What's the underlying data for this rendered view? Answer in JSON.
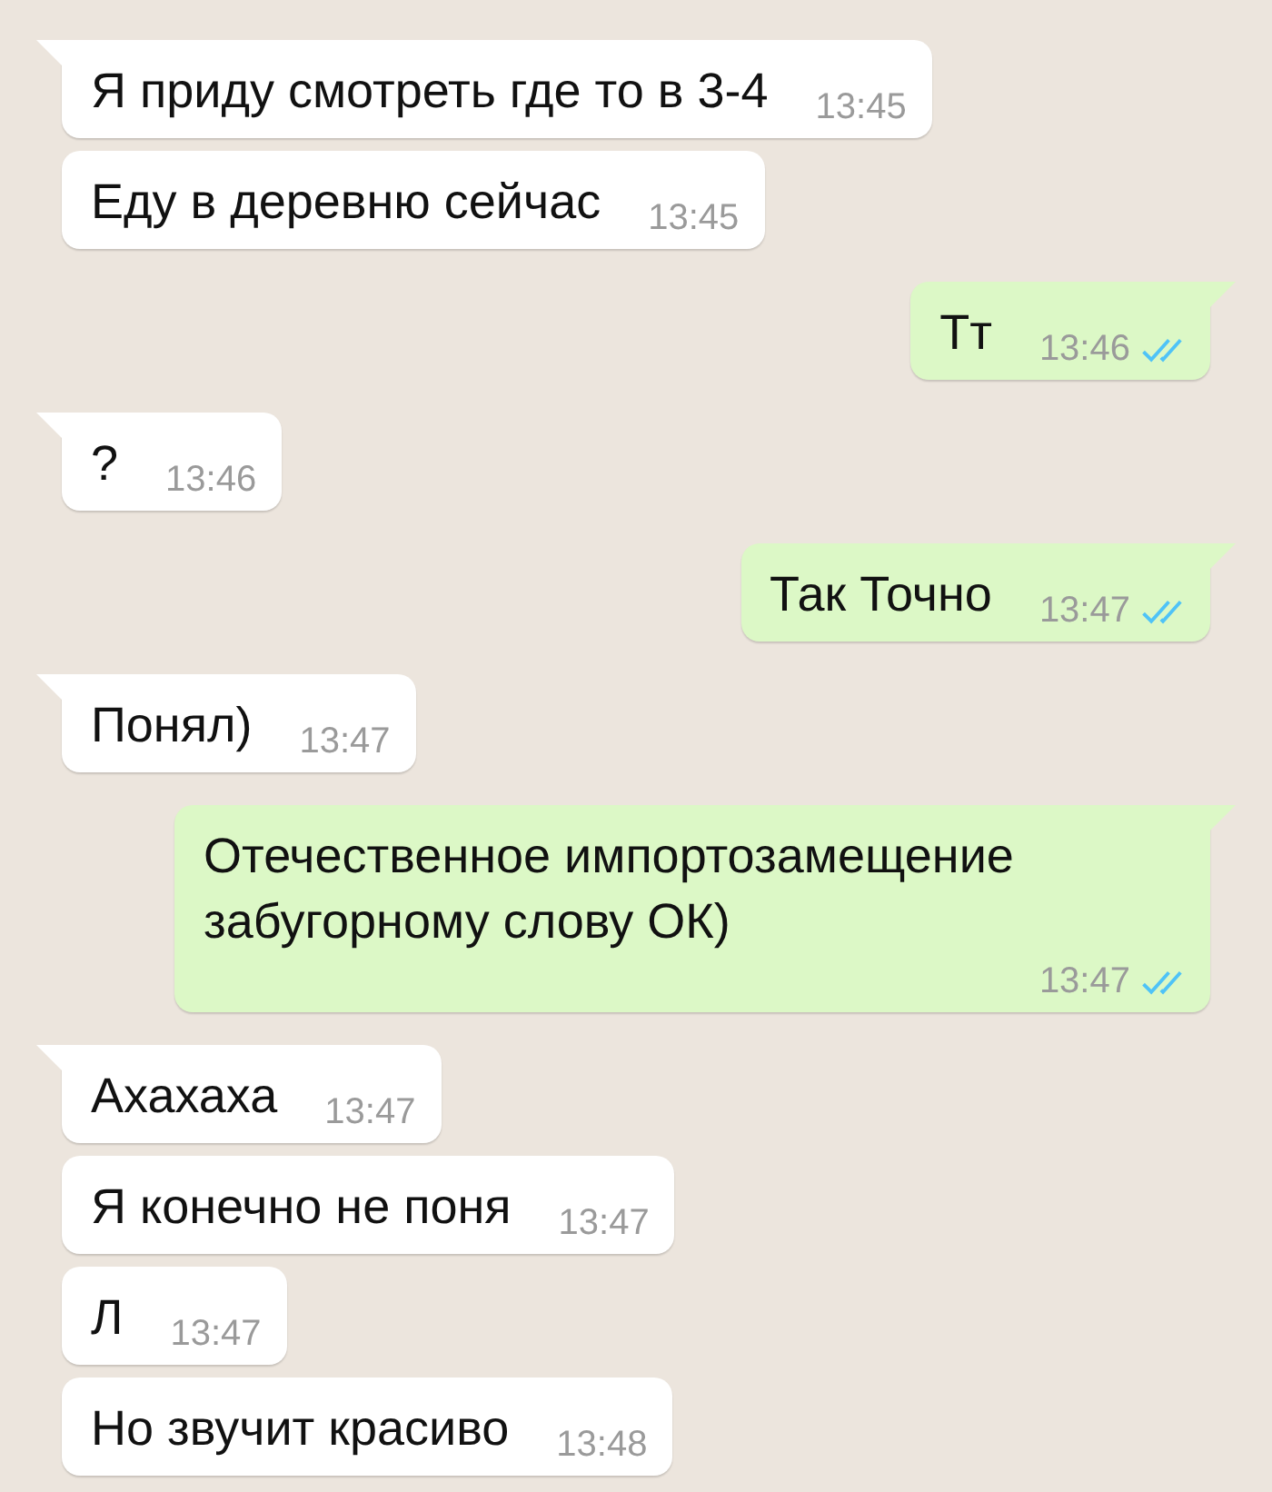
{
  "messages": [
    {
      "outgoing": false,
      "tail": true,
      "text": "Я приду смотреть где то в 3-4",
      "time": "13:45"
    },
    {
      "outgoing": false,
      "tail": false,
      "text": "Еду в деревню сейчас",
      "time": "13:45"
    },
    {
      "outgoing": true,
      "tail": true,
      "text": "Тт",
      "time": "13:46",
      "read": true
    },
    {
      "outgoing": false,
      "tail": true,
      "text": "?",
      "time": "13:46"
    },
    {
      "outgoing": true,
      "tail": true,
      "text": "Так Точно",
      "time": "13:47",
      "read": true
    },
    {
      "outgoing": false,
      "tail": true,
      "text": "Понял)",
      "time": "13:47"
    },
    {
      "outgoing": true,
      "tail": true,
      "text": "Отечественное импортозамещение забугорному слову ОК)",
      "time": "13:47",
      "read": true
    },
    {
      "outgoing": false,
      "tail": true,
      "text": "Ахахаха",
      "time": "13:47"
    },
    {
      "outgoing": false,
      "tail": false,
      "text": "Я конечно не поня",
      "time": "13:47"
    },
    {
      "outgoing": false,
      "tail": false,
      "text": "Л",
      "time": "13:47"
    },
    {
      "outgoing": false,
      "tail": false,
      "text": "Но звучит красиво",
      "time": "13:48"
    }
  ]
}
